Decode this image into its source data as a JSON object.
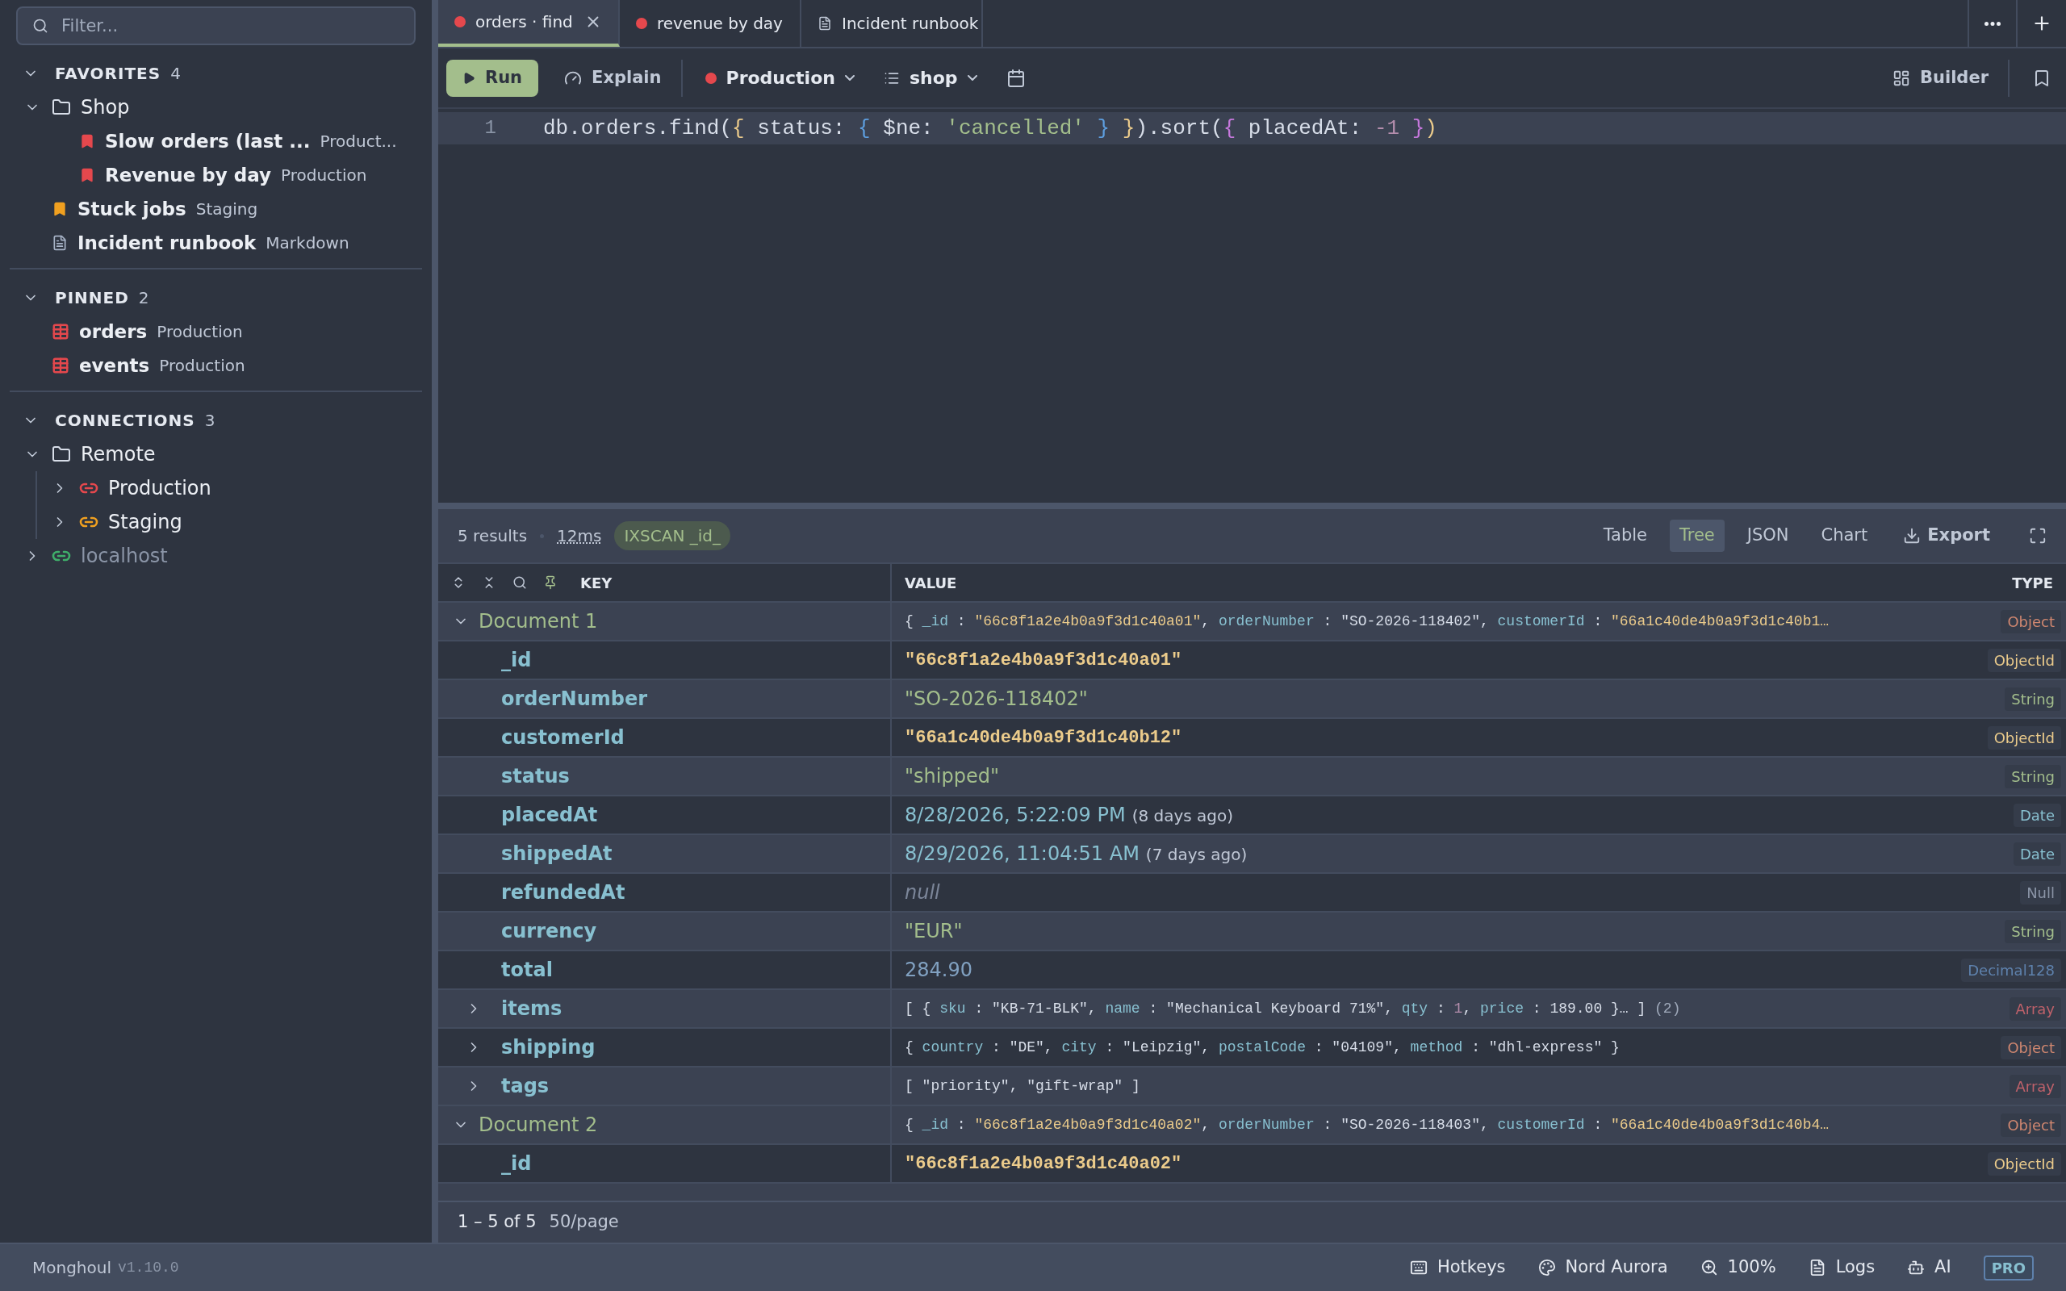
{
  "sidebar": {
    "filter": {
      "placeholder": "Filter..."
    },
    "sections": [
      {
        "title": "FAVORITES",
        "count": "4",
        "expanded": true,
        "items": [
          {
            "kind": "folder",
            "label": "Shop",
            "expanded": true,
            "children": [
              {
                "kind": "bookmark",
                "color": "#e5484d",
                "label": "Slow orders (last ...",
                "detail": "Product..."
              },
              {
                "kind": "bookmark",
                "color": "#e5484d",
                "label": "Revenue by day",
                "detail": "Production"
              }
            ]
          },
          {
            "kind": "bookmark",
            "color": "#f0a020",
            "label": "Stuck jobs",
            "detail": "Staging"
          },
          {
            "kind": "doc",
            "label": "Incident runbook",
            "detail": "Markdown"
          }
        ]
      },
      {
        "title": "PINNED",
        "count": "2",
        "expanded": true,
        "items": [
          {
            "kind": "table",
            "color": "#e5484d",
            "label": "orders",
            "detail": "Production"
          },
          {
            "kind": "table",
            "color": "#e5484d",
            "label": "events",
            "detail": "Production"
          }
        ]
      },
      {
        "title": "CONNECTIONS",
        "count": "3",
        "expanded": true,
        "items": [
          {
            "kind": "folder",
            "label": "Remote",
            "expanded": true,
            "children": [
              {
                "kind": "link",
                "color": "#e5484d",
                "label": "Production",
                "expanded": false,
                "connected": true
              },
              {
                "kind": "link",
                "color": "#f0a020",
                "label": "Staging",
                "expanded": false,
                "connected": true
              }
            ]
          },
          {
            "kind": "link",
            "color": "#3fae6a",
            "label": "localhost",
            "expanded": false,
            "connected": false
          }
        ]
      }
    ]
  },
  "tabs": [
    {
      "kind": "query",
      "color": "#e5484d",
      "label": "orders · find",
      "selected": true
    },
    {
      "kind": "query",
      "color": "#e5484d",
      "label": "revenue by day",
      "selected": false
    },
    {
      "kind": "doc",
      "label": "Incident runbook",
      "selected": false
    }
  ],
  "toolbar": {
    "run": "Run",
    "explain": "Explain",
    "connection": {
      "label": "Production",
      "color": "#e5484d"
    },
    "database": "shop",
    "builder": "Builder"
  },
  "editor": {
    "lines": [
      {
        "number": "1",
        "tokens": [
          {
            "kind": "plain",
            "text": "db.orders.find("
          },
          {
            "kind": "b1",
            "text": "{"
          },
          {
            "kind": "plain",
            "text": " status: "
          },
          {
            "kind": "b2",
            "text": "{"
          },
          {
            "kind": "plain",
            "text": " $ne: "
          },
          {
            "kind": "str",
            "text": "'cancelled'"
          },
          {
            "kind": "b2",
            "text": " }"
          },
          {
            "kind": "b1",
            "text": " }"
          },
          {
            "kind": "plain",
            "text": ").sort("
          },
          {
            "kind": "b3",
            "text": "{"
          },
          {
            "kind": "plain",
            "text": " placedAt: "
          },
          {
            "kind": "num",
            "text": "-1"
          },
          {
            "kind": "b3",
            "text": " }"
          },
          {
            "kind": "b1",
            "text": ")"
          }
        ]
      }
    ]
  },
  "results": {
    "count": "5 results",
    "time": "12ms",
    "plan": "IXSCAN _id_",
    "views": [
      {
        "label": "Table",
        "selected": false
      },
      {
        "label": "Tree",
        "selected": true
      },
      {
        "label": "JSON",
        "selected": false
      },
      {
        "label": "Chart",
        "selected": false
      }
    ],
    "export": "Export",
    "columns": {
      "key": "KEY",
      "value": "VALUE",
      "type": "TYPE"
    },
    "rows": [
      {
        "key": "Document 1",
        "expanded": true,
        "kind": "summary",
        "tokens": [
          {
            "kind": "p",
            "text": "{ "
          },
          {
            "kind": "k",
            "text": "_id"
          },
          {
            "kind": "p",
            "text": " : "
          },
          {
            "kind": "id",
            "text": "\"66c8f1a2e4b0a9f3d1c40a01\""
          },
          {
            "kind": "p",
            "text": ", "
          },
          {
            "kind": "k",
            "text": "orderNumber"
          },
          {
            "kind": "p",
            "text": " : "
          },
          {
            "kind": "s",
            "text": "\"SO-2026-118402\""
          },
          {
            "kind": "p",
            "text": ", "
          },
          {
            "kind": "k",
            "text": "customerId"
          },
          {
            "kind": "p",
            "text": " : "
          },
          {
            "kind": "id",
            "text": "\"66a1c40de4b0a9f3d1c40b1…"
          }
        ],
        "type": {
          "label": "Object",
          "kind": "object"
        },
        "children": [
          {
            "key": "_id",
            "kind": "id",
            "value": "\"66c8f1a2e4b0a9f3d1c40a01\"",
            "type": {
              "label": "ObjectId",
              "kind": "objectid"
            }
          },
          {
            "key": "orderNumber",
            "kind": "string",
            "value": "\"SO-2026-118402\"",
            "type": {
              "label": "String",
              "kind": "string"
            }
          },
          {
            "key": "customerId",
            "kind": "id",
            "value": "\"66a1c40de4b0a9f3d1c40b12\"",
            "type": {
              "label": "ObjectId",
              "kind": "objectid"
            }
          },
          {
            "key": "status",
            "kind": "string",
            "value": "\"shipped\"",
            "type": {
              "label": "String",
              "kind": "string"
            }
          },
          {
            "key": "placedAt",
            "kind": "date",
            "value": "8/28/2026, 5:22:09 PM",
            "note": "(8 days ago)",
            "type": {
              "label": "Date",
              "kind": "date"
            }
          },
          {
            "key": "shippedAt",
            "kind": "date",
            "value": "8/29/2026, 11:04:51 AM",
            "note": "(7 days ago)",
            "type": {
              "label": "Date",
              "kind": "date"
            }
          },
          {
            "key": "refundedAt",
            "kind": "null",
            "value": "null",
            "type": {
              "label": "Null",
              "kind": "null"
            }
          },
          {
            "key": "currency",
            "kind": "string",
            "value": "\"EUR\"",
            "type": {
              "label": "String",
              "kind": "string"
            }
          },
          {
            "key": "total",
            "kind": "number",
            "value": "284.90",
            "type": {
              "label": "Decimal128",
              "kind": "decimal"
            }
          },
          {
            "key": "items",
            "expanded": false,
            "kind": "summary",
            "tokens": [
              {
                "kind": "p",
                "text": "[ { "
              },
              {
                "kind": "k",
                "text": "sku"
              },
              {
                "kind": "p",
                "text": " : "
              },
              {
                "kind": "s",
                "text": "\"KB-71-BLK\""
              },
              {
                "kind": "p",
                "text": ", "
              },
              {
                "kind": "k",
                "text": "name"
              },
              {
                "kind": "p",
                "text": " : "
              },
              {
                "kind": "s",
                "text": "\"Mechanical Keyboard 71%\""
              },
              {
                "kind": "p",
                "text": ", "
              },
              {
                "kind": "k",
                "text": "qty"
              },
              {
                "kind": "p",
                "text": " : "
              },
              {
                "kind": "n",
                "text": "1"
              },
              {
                "kind": "p",
                "text": ", "
              },
              {
                "kind": "k",
                "text": "price"
              },
              {
                "kind": "p",
                "text": " : "
              },
              {
                "kind": "s",
                "text": "189.00"
              },
              {
                "kind": "p",
                "text": " }… ] "
              },
              {
                "kind": "c",
                "text": "(2)"
              }
            ],
            "type": {
              "label": "Array",
              "kind": "array"
            }
          },
          {
            "key": "shipping",
            "expanded": false,
            "kind": "summary",
            "tokens": [
              {
                "kind": "p",
                "text": "{ "
              },
              {
                "kind": "k",
                "text": "country"
              },
              {
                "kind": "p",
                "text": " : "
              },
              {
                "kind": "s",
                "text": "\"DE\""
              },
              {
                "kind": "p",
                "text": ", "
              },
              {
                "kind": "k",
                "text": "city"
              },
              {
                "kind": "p",
                "text": " : "
              },
              {
                "kind": "s",
                "text": "\"Leipzig\""
              },
              {
                "kind": "p",
                "text": ", "
              },
              {
                "kind": "k",
                "text": "postalCode"
              },
              {
                "kind": "p",
                "text": " : "
              },
              {
                "kind": "s",
                "text": "\"04109\""
              },
              {
                "kind": "p",
                "text": ", "
              },
              {
                "kind": "k",
                "text": "method"
              },
              {
                "kind": "p",
                "text": " : "
              },
              {
                "kind": "s",
                "text": "\"dhl-express\""
              },
              {
                "kind": "p",
                "text": " }"
              }
            ],
            "type": {
              "label": "Object",
              "kind": "object"
            }
          },
          {
            "key": "tags",
            "expanded": false,
            "kind": "summary",
            "tokens": [
              {
                "kind": "p",
                "text": "[ "
              },
              {
                "kind": "s",
                "text": "\"priority\""
              },
              {
                "kind": "p",
                "text": ", "
              },
              {
                "kind": "s",
                "text": "\"gift-wrap\""
              },
              {
                "kind": "p",
                "text": " ]"
              }
            ],
            "type": {
              "label": "Array",
              "kind": "array"
            }
          }
        ]
      },
      {
        "key": "Document 2",
        "expanded": true,
        "kind": "summary",
        "tokens": [
          {
            "kind": "p",
            "text": "{ "
          },
          {
            "kind": "k",
            "text": "_id"
          },
          {
            "kind": "p",
            "text": " : "
          },
          {
            "kind": "id",
            "text": "\"66c8f1a2e4b0a9f3d1c40a02\""
          },
          {
            "kind": "p",
            "text": ", "
          },
          {
            "kind": "k",
            "text": "orderNumber"
          },
          {
            "kind": "p",
            "text": " : "
          },
          {
            "kind": "s",
            "text": "\"SO-2026-118403\""
          },
          {
            "kind": "p",
            "text": ", "
          },
          {
            "kind": "k",
            "text": "customerId"
          },
          {
            "kind": "p",
            "text": " : "
          },
          {
            "kind": "id",
            "text": "\"66a1c40de4b0a9f3d1c40b4…"
          }
        ],
        "type": {
          "label": "Object",
          "kind": "object"
        },
        "children": [
          {
            "key": "_id",
            "kind": "id",
            "value": "\"66c8f1a2e4b0a9f3d1c40a02\"",
            "type": {
              "label": "ObjectId",
              "kind": "objectid"
            }
          }
        ]
      }
    ],
    "pagination": {
      "range": "1 – 5 of 5",
      "page_size": "50/page"
    }
  },
  "status_bar": {
    "app": "Monghoul",
    "version": "v1.10.0",
    "hotkeys": "Hotkeys",
    "theme": "Nord Aurora",
    "zoom": "100%",
    "logs": "Logs",
    "ai": "AI",
    "plan": "PRO"
  }
}
